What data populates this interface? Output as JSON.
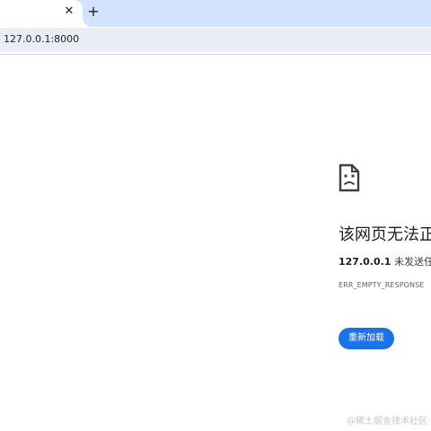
{
  "tab_strip": {
    "close_glyph": "✕",
    "new_tab_glyph": "+"
  },
  "address_bar": {
    "url": "127.0.0.1:8000"
  },
  "error_page": {
    "icon": "sad-page-icon",
    "title": "该网页无法正",
    "host": "127.0.0.1",
    "description_suffix": " 未发送任何",
    "error_code": "ERR_EMPTY_RESPONSE",
    "reload_label": "重新加载"
  },
  "watermark": "@稀土掘金技术社区",
  "colors": {
    "tab_strip": "#d3e3fd",
    "omnibox": "#e9eef6",
    "button": "#1a73e8",
    "title_text": "#202124"
  }
}
